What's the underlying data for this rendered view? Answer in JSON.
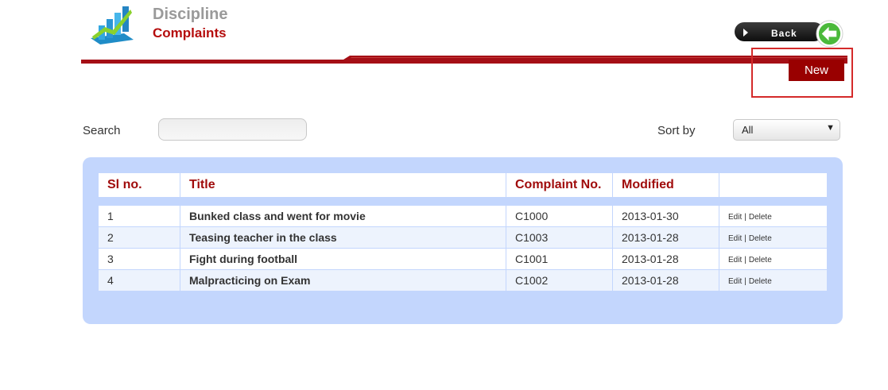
{
  "header": {
    "title": "Discipline",
    "subtitle": "Complaints",
    "back_label": "Back",
    "new_label": "New",
    "accent": "#990000"
  },
  "filters": {
    "search_label": "Search",
    "search_value": "",
    "sort_label": "Sort by",
    "sort_value": "All"
  },
  "table": {
    "columns": [
      "Sl no.",
      "Title",
      "Complaint No.",
      "Modified",
      ""
    ],
    "rows": [
      {
        "sl": "1",
        "title": "Bunked class and went for movie",
        "complaint_no": "C1000",
        "modified": "2013-01-30",
        "edit": "Edit",
        "sep": "|",
        "delete": "Delete"
      },
      {
        "sl": "2",
        "title": "Teasing teacher in the class",
        "complaint_no": "C1003",
        "modified": "2013-01-28",
        "edit": "Edit",
        "sep": "|",
        "delete": "Delete"
      },
      {
        "sl": "3",
        "title": "Fight during football",
        "complaint_no": "C1001",
        "modified": "2013-01-28",
        "edit": "Edit",
        "sep": "|",
        "delete": "Delete"
      },
      {
        "sl": "4",
        "title": "Malpracticing on Exam",
        "complaint_no": "C1002",
        "modified": "2013-01-28",
        "edit": "Edit",
        "sep": "|",
        "delete": "Delete"
      }
    ]
  }
}
